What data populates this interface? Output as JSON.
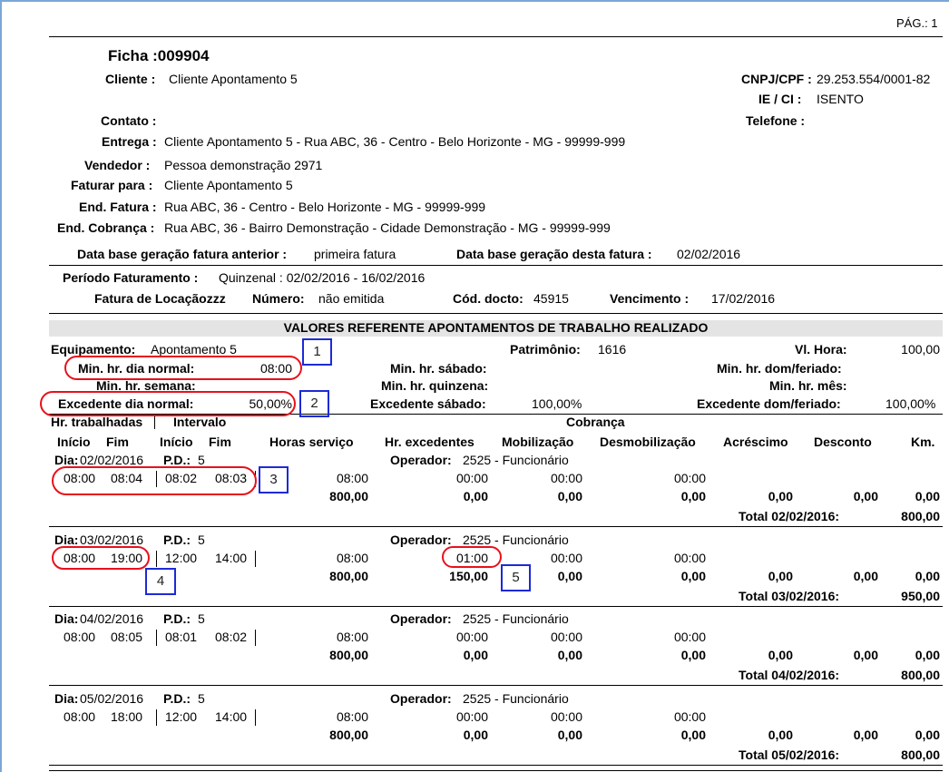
{
  "page": {
    "label": "PÁG.: 1"
  },
  "header": {
    "ficha": "Ficha :009904",
    "cliente_label": "Cliente :",
    "cliente": "Cliente Apontamento 5",
    "cnpj_label": "CNPJ/CPF :",
    "cnpj": "29.253.554/0001-82",
    "ie_label": "IE / CI :",
    "ie": "ISENTO",
    "contato_label": "Contato :",
    "telefone_label": "Telefone :",
    "entrega_label": "Entrega :",
    "entrega": "Cliente Apontamento 5 - Rua ABC, 36 - Centro - Belo Horizonte - MG - 99999-999",
    "vendedor_label": "Vendedor :",
    "vendedor": "Pessoa demonstração 2971",
    "faturar_label": "Faturar para :",
    "faturar": "Cliente Apontamento 5",
    "endfatura_label": "End. Fatura :",
    "endfatura": "Rua ABC, 36 - Centro - Belo Horizonte - MG - 99999-999",
    "endcobranca_label": "End. Cobrança :",
    "endcobranca": "Rua ABC, 36 - Bairro Demonstração - Cidade Demonstração - MG - 99999-999",
    "dbant_label": "Data base geração fatura anterior :",
    "dbant": "primeira fatura",
    "dbdesta_label": "Data base geração desta fatura :",
    "dbdesta": "02/02/2016"
  },
  "billing": {
    "periodo_label": "Período Faturamento :",
    "periodo": "Quinzenal : 02/02/2016 - 16/02/2016",
    "fatura_label": "Fatura de Locaçãozzz",
    "numero_label": "Número:",
    "numero": "não emitida",
    "coddocto_label": "Cód. docto:",
    "coddocto": "45915",
    "venc_label": "Vencimento :",
    "venc": "17/02/2016"
  },
  "section": {
    "title": "VALORES REFERENTE APONTAMENTOS DE TRABALHO REALIZADO",
    "equip_label": "Equipamento:",
    "equip": "Apontamento 5",
    "patrimonio_label": "Patrimônio:",
    "patrimonio": "1616",
    "vlhora_label": "Vl. Hora:",
    "vlhora": "100,00",
    "minnormal_label": "Min. hr. dia normal:",
    "minnormal": "08:00",
    "minsabado_label": "Min. hr. sábado:",
    "mindom_label": "Min. hr. dom/feriado:",
    "minsemana_label": "Min. hr. semana:",
    "minquinzena_label": "Min. hr. quinzena:",
    "minmes_label": "Min. hr. mês:",
    "excnormal_label": "Excedente dia normal:",
    "excnormal": "50,00%",
    "excsabado_label": "Excedente sábado:",
    "excsabado": "100,00%",
    "excdom_label": "Excedente dom/feriado:",
    "excdom": "100,00%"
  },
  "columns": {
    "hrtrab": "Hr. trabalhadas",
    "intervalo": "Intervalo",
    "cobranca": "Cobrança",
    "inicio": "Início",
    "fim": "Fim",
    "inicio2": "Início",
    "fim2": "Fim",
    "horas": "Horas serviço",
    "hrexc": "Hr. excedentes",
    "mobil": "Mobilização",
    "desmobil": "Desmobilização",
    "acresc": "Acréscimo",
    "desconto": "Desconto",
    "km": "Km."
  },
  "days": [
    {
      "dia_label": "Dia:",
      "dia": "02/02/2016",
      "pd_label": "P.D.:",
      "pd": "5",
      "op_label": "Operador:",
      "op": "2525 - Funcionário",
      "ini": "08:00",
      "fim": "08:04",
      "ini2": "08:02",
      "fim2": "08:03",
      "horas": "08:00",
      "hrexc": "00:00",
      "mobil": "00:00",
      "desmobil": "00:00",
      "v_horas": "800,00",
      "v_hrexc": "0,00",
      "v_mobil": "0,00",
      "v_desmobil": "0,00",
      "v_acresc": "0,00",
      "v_desc": "0,00",
      "v_km": "0,00",
      "total_label": "Total 02/02/2016:",
      "total": "800,00"
    },
    {
      "dia_label": "Dia:",
      "dia": "03/02/2016",
      "pd_label": "P.D.:",
      "pd": "5",
      "op_label": "Operador:",
      "op": "2525 - Funcionário",
      "ini": "08:00",
      "fim": "19:00",
      "ini2": "12:00",
      "fim2": "14:00",
      "horas": "08:00",
      "hrexc": "01:00",
      "mobil": "00:00",
      "desmobil": "00:00",
      "v_horas": "800,00",
      "v_hrexc": "150,00",
      "v_mobil": "0,00",
      "v_desmobil": "0,00",
      "v_acresc": "0,00",
      "v_desc": "0,00",
      "v_km": "0,00",
      "total_label": "Total 03/02/2016:",
      "total": "950,00"
    },
    {
      "dia_label": "Dia:",
      "dia": "04/02/2016",
      "pd_label": "P.D.:",
      "pd": "5",
      "op_label": "Operador:",
      "op": "2525 - Funcionário",
      "ini": "08:00",
      "fim": "08:05",
      "ini2": "08:01",
      "fim2": "08:02",
      "horas": "08:00",
      "hrexc": "00:00",
      "mobil": "00:00",
      "desmobil": "00:00",
      "v_horas": "800,00",
      "v_hrexc": "0,00",
      "v_mobil": "0,00",
      "v_desmobil": "0,00",
      "v_acresc": "0,00",
      "v_desc": "0,00",
      "v_km": "0,00",
      "total_label": "Total 04/02/2016:",
      "total": "800,00"
    },
    {
      "dia_label": "Dia:",
      "dia": "05/02/2016",
      "pd_label": "P.D.:",
      "pd": "5",
      "op_label": "Operador:",
      "op": "2525 - Funcionário",
      "ini": "08:00",
      "fim": "18:00",
      "ini2": "12:00",
      "fim2": "14:00",
      "horas": "08:00",
      "hrexc": "00:00",
      "mobil": "00:00",
      "desmobil": "00:00",
      "v_horas": "800,00",
      "v_hrexc": "0,00",
      "v_mobil": "0,00",
      "v_desmobil": "0,00",
      "v_acresc": "0,00",
      "v_desc": "0,00",
      "v_km": "0,00",
      "total_label": "Total 05/02/2016:",
      "total": "800,00"
    }
  ],
  "markers": {
    "m1": "1",
    "m2": "2",
    "m3": "3",
    "m4": "4",
    "m5": "5"
  }
}
